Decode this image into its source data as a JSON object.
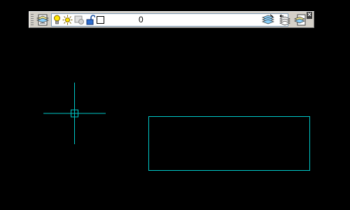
{
  "toolbar": {
    "layer_combo": {
      "current_layer": "0"
    },
    "icons": {
      "layer_properties_manager": "layer-properties-manager-icon",
      "on_off": "lightbulb-icon",
      "freeze_thaw": "sun-icon",
      "freeze_viewport": "freeze-viewport-icon",
      "lock_unlock": "unlock-icon",
      "color_swatch": "color-swatch-icon",
      "make_current": "make-object-layer-current-icon",
      "layer_previous": "layer-previous-icon",
      "layer_states": "layer-states-manager-icon",
      "close": "close-icon"
    },
    "close_label": "×"
  },
  "colors": {
    "drawing_area": "#000000",
    "entity": "#00c8c8",
    "toolbar": "#d4d0c8"
  }
}
